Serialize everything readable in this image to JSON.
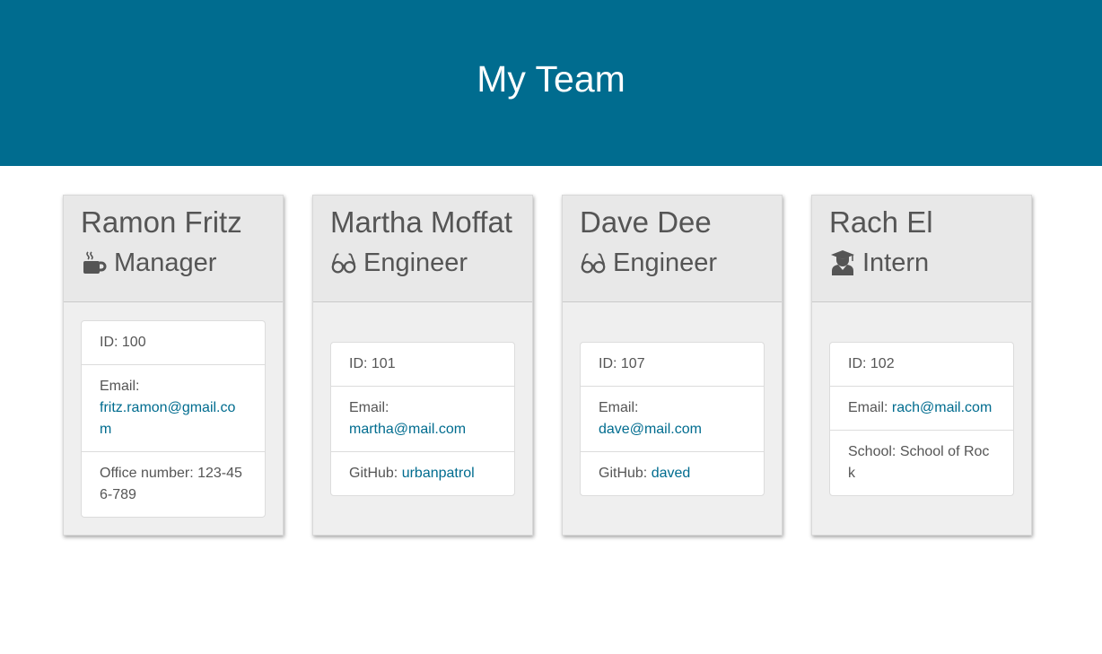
{
  "header": {
    "title": "My Team"
  },
  "colors": {
    "header_bg": "#006c8f",
    "link": "#006c8f"
  },
  "team": [
    {
      "name": "Ramon Fritz",
      "role": "Manager",
      "role_icon": "coffee-mug-icon",
      "id_label": "ID: 100",
      "email_label": "Email:",
      "email": "fritz.ramon@gmail.com",
      "extra_label": "Office number: 123-456-789",
      "extra_value": ""
    },
    {
      "name": "Martha Moffat",
      "role": "Engineer",
      "role_icon": "glasses-icon",
      "id_label": "ID: 101",
      "email_label": "Email:",
      "email": "martha@mail.com",
      "extra_label": "GitHub:",
      "extra_value": "urbanpatrol"
    },
    {
      "name": "Dave Dee",
      "role": "Engineer",
      "role_icon": "glasses-icon",
      "id_label": "ID: 107",
      "email_label": "Email:",
      "email": "dave@mail.com",
      "extra_label": "GitHub:",
      "extra_value": "daved"
    },
    {
      "name": "Rach El",
      "role": "Intern",
      "role_icon": "graduate-icon",
      "id_label": "ID: 102",
      "email_label": "Email:",
      "email": "rach@mail.com",
      "extra_label": "School: School of Rock",
      "extra_value": ""
    }
  ]
}
